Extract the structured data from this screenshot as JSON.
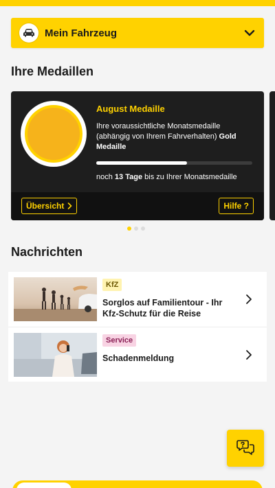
{
  "vehicle": {
    "label": "Mein Fahrzeug"
  },
  "medals": {
    "heading": "Ihre Medaillen",
    "card": {
      "title": "August Medaille",
      "desc_prefix": "Ihre voraussichtliche Monatsmedaille (abhängig von Ihrem Fahrverhalten) ",
      "desc_bold": "Gold Medaille",
      "progress": 0.58,
      "days_prefix": "noch ",
      "days_bold": "13 Tage",
      "days_suffix": " bis zu Ihrer Monatsmedaille",
      "overview_button": "Übersicht",
      "help_button": "Hilfe ?"
    },
    "dots": {
      "count": 3,
      "active_index": 0
    }
  },
  "news": {
    "heading": "Nachrichten",
    "items": [
      {
        "tag": "KfZ",
        "title": "Sorglos auf Familientour - Ihr Kfz-Schutz für die Reise"
      },
      {
        "tag": "Service",
        "title": "Schadenmeldung"
      }
    ]
  },
  "colors": {
    "brand_yellow": "#ffd200",
    "card_dark": "#1e1e1e",
    "tag_kfz_bg": "#fff3b0",
    "tag_service_bg": "#f8d3e3"
  },
  "icons": {
    "vehicle": "car-icon",
    "dropdown": "chevron-down-icon",
    "arrow": "chevron-right-icon",
    "chat": "chat-help-icon"
  }
}
